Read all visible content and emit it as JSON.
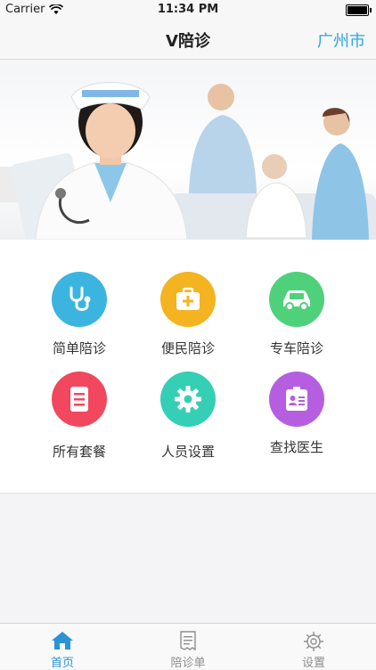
{
  "status_bar": {
    "carrier": "Carrier",
    "time": "11:34 PM"
  },
  "navbar": {
    "title": "V陪诊",
    "city": "广州市"
  },
  "banner": {
    "alt": "nurse-and-patient-banner"
  },
  "services": [
    {
      "label": "简单陪诊",
      "icon": "stethoscope-icon",
      "color": "#3bb4e0"
    },
    {
      "label": "便民陪诊",
      "icon": "medical-kit-icon",
      "color": "#f4b321"
    },
    {
      "label": "专车陪诊",
      "icon": "car-icon",
      "color": "#4fd17b"
    },
    {
      "label": "所有套餐",
      "icon": "document-icon",
      "color": "#f1475f"
    },
    {
      "label": "人员设置",
      "icon": "gear-icon",
      "color": "#35cfb6"
    },
    {
      "label": "查找医生",
      "icon": "id-card-icon",
      "color": "#b55fe0"
    }
  ],
  "tabbar": {
    "items": [
      {
        "label": "首页",
        "icon": "home-icon",
        "active": true
      },
      {
        "label": "陪诊单",
        "icon": "receipt-icon",
        "active": false
      },
      {
        "label": "设置",
        "icon": "gear-icon",
        "active": false
      }
    ],
    "active_color": "#2a93d6",
    "inactive_color": "#8e8e8e"
  }
}
